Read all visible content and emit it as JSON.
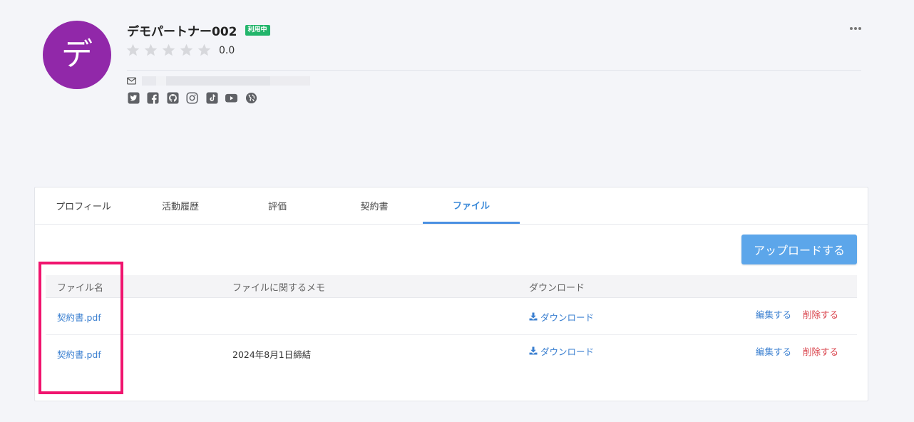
{
  "profile": {
    "avatar_initial": "デ",
    "avatar_color": "#9128a9",
    "name": "デモパートナー002",
    "status_badge": "利用中",
    "rating": "0.0",
    "stars_filled": 0,
    "stars_total": 5
  },
  "social_icons": [
    "twitter-icon",
    "facebook-icon",
    "github-icon",
    "instagram-icon",
    "tiktok-icon",
    "youtube-icon",
    "website-icon"
  ],
  "tabs": [
    {
      "label": "プロフィール",
      "active": false
    },
    {
      "label": "活動履歴",
      "active": false
    },
    {
      "label": "評価",
      "active": false
    },
    {
      "label": "契約書",
      "active": false
    },
    {
      "label": "ファイル",
      "active": true
    }
  ],
  "upload_button": "アップロードする",
  "table": {
    "headers": [
      "ファイル名",
      "ファイルに関するメモ",
      "ダウンロード"
    ],
    "rows": [
      {
        "file_name": "契約書.pdf",
        "memo": "",
        "download": "ダウンロード",
        "edit": "編集する",
        "delete": "削除する"
      },
      {
        "file_name": "契約書.pdf",
        "memo": "2024年8月1日締結",
        "download": "ダウンロード",
        "edit": "編集する",
        "delete": "削除する"
      }
    ]
  },
  "colors": {
    "accent": "#4a90e2",
    "badge": "#22b56b",
    "danger": "#d9414a",
    "highlight": "#f0146e"
  }
}
